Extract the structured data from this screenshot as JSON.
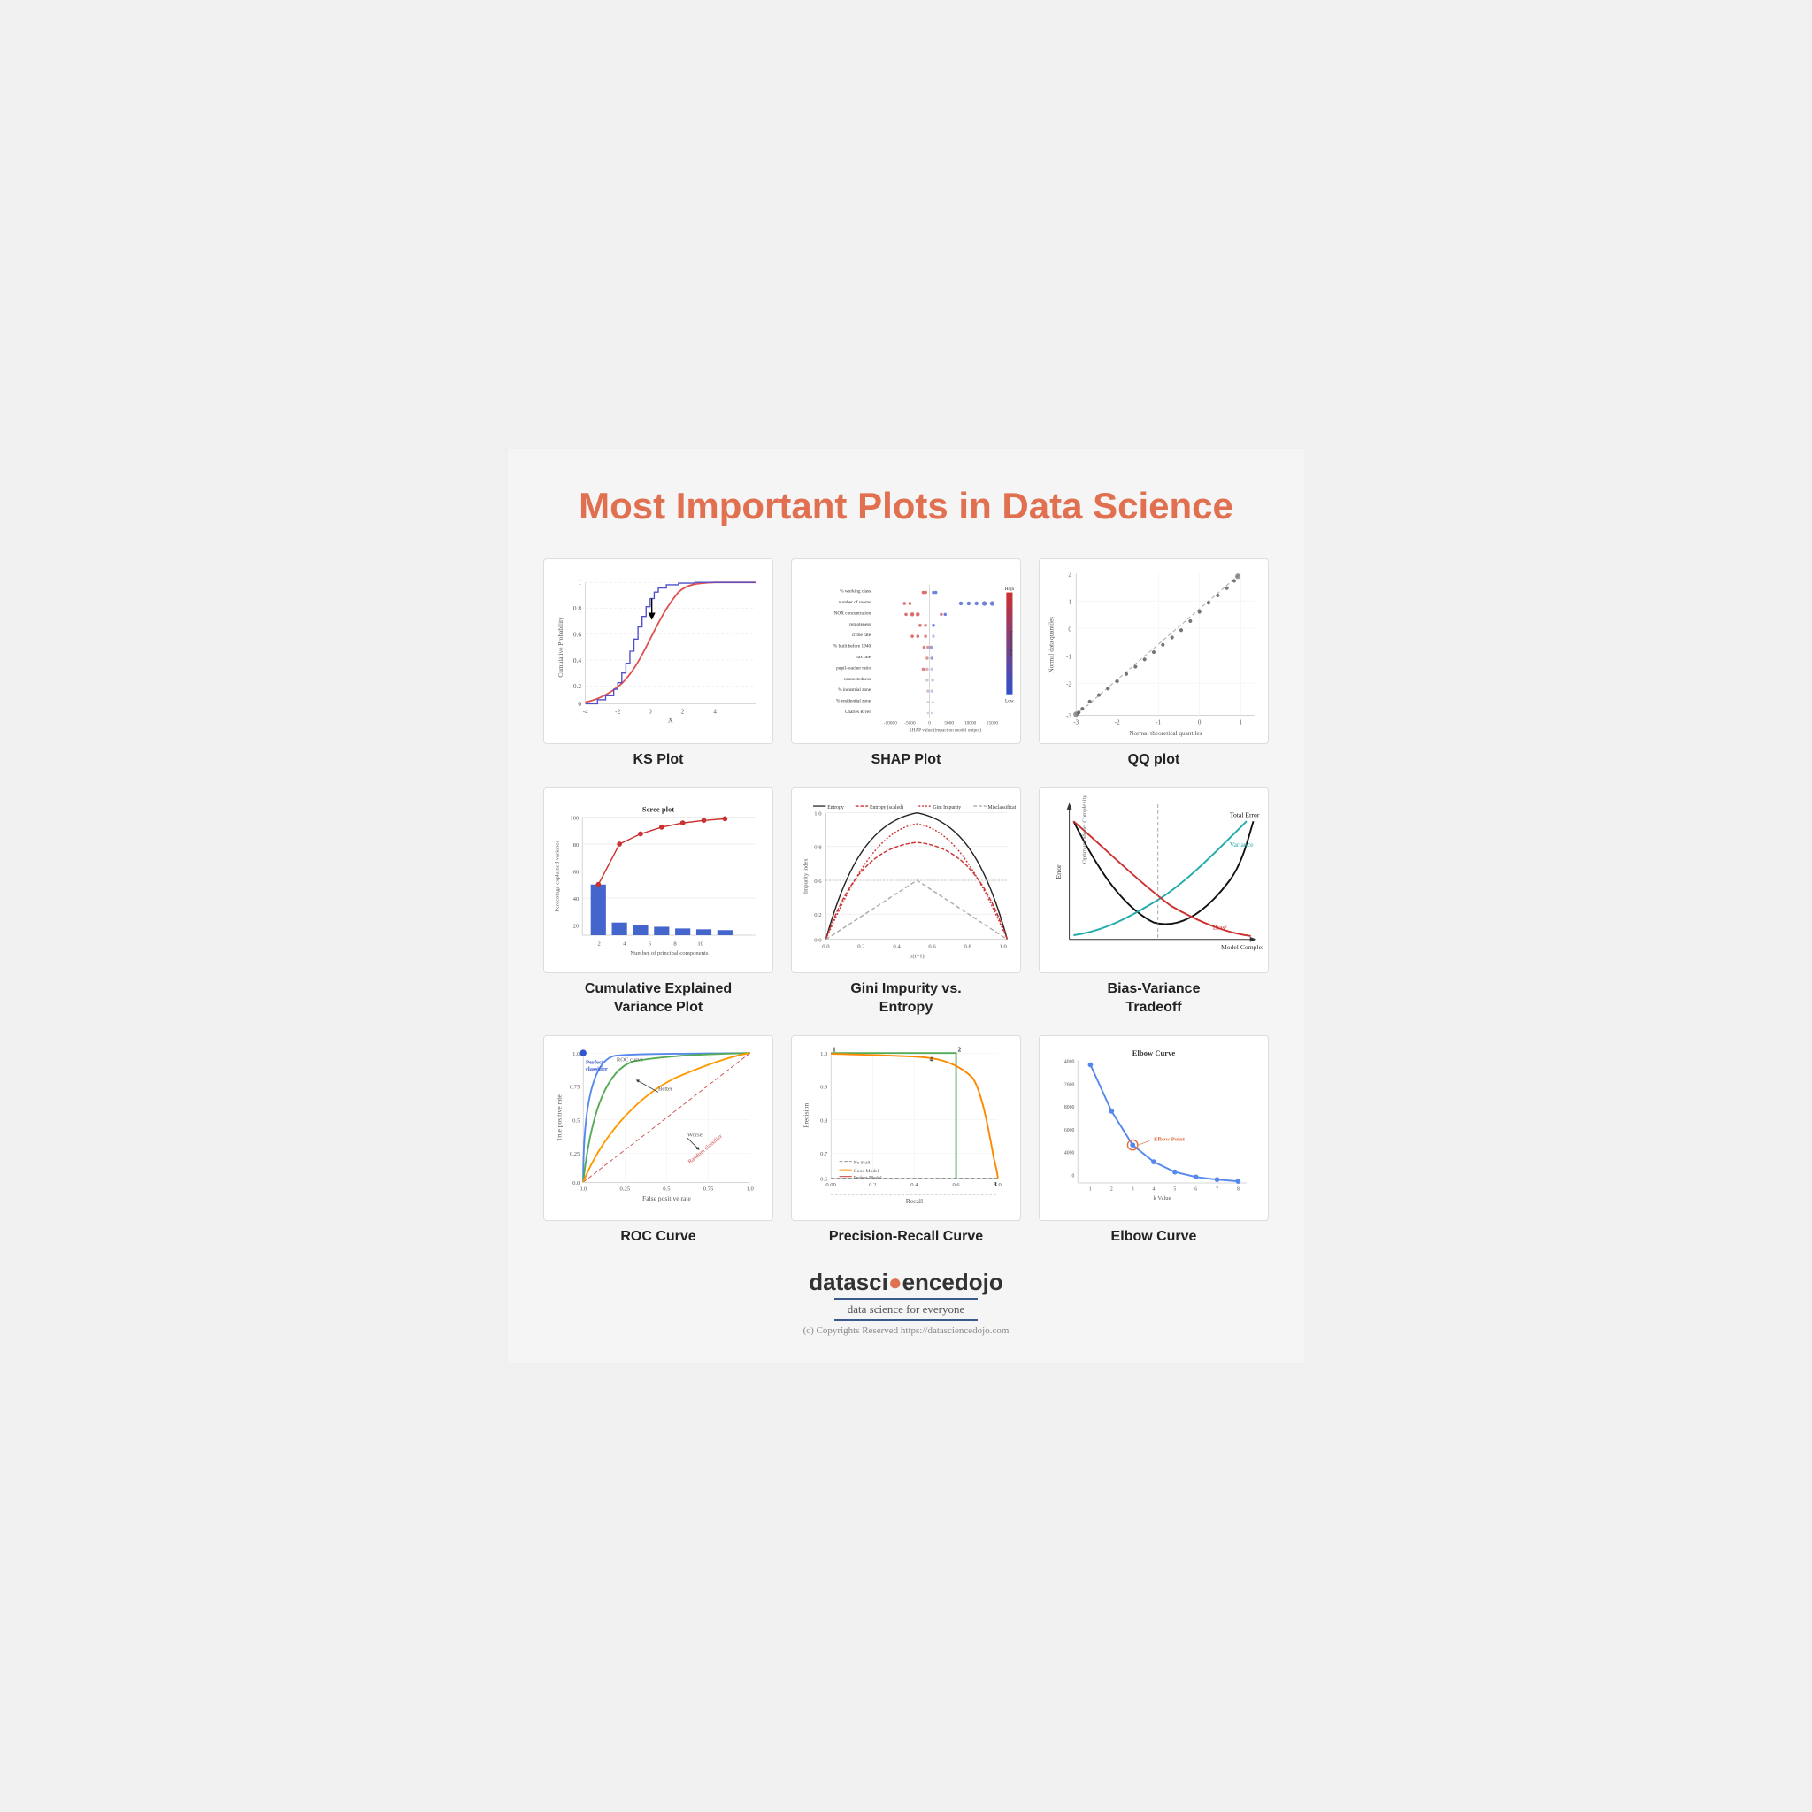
{
  "title": {
    "prefix": "Most Important Plots in ",
    "highlight": "Data Science"
  },
  "plots": [
    {
      "id": "ks-plot",
      "label": "KS Plot"
    },
    {
      "id": "shap-plot",
      "label": "SHAP Plot"
    },
    {
      "id": "qq-plot",
      "label": "QQ plot"
    },
    {
      "id": "scree-plot",
      "label": "Cumulative Explained\nVariance Plot"
    },
    {
      "id": "gini-plot",
      "label": "Gini Impurity vs.\nEntropy"
    },
    {
      "id": "bv-plot",
      "label": "Bias-Variance\nTradeoff"
    },
    {
      "id": "roc-plot",
      "label": "ROC Curve"
    },
    {
      "id": "pr-plot",
      "label": "Precision-Recall Curve"
    },
    {
      "id": "elbow-plot",
      "label": "Elbow Curve"
    }
  ],
  "footer": {
    "logo_text1": "datasci",
    "logo_dot": "●",
    "logo_text2": "encedojo",
    "tagline": "data science for everyone",
    "copyright": "(c) Copyrights Reserved  https://datasciencedojo.com"
  }
}
